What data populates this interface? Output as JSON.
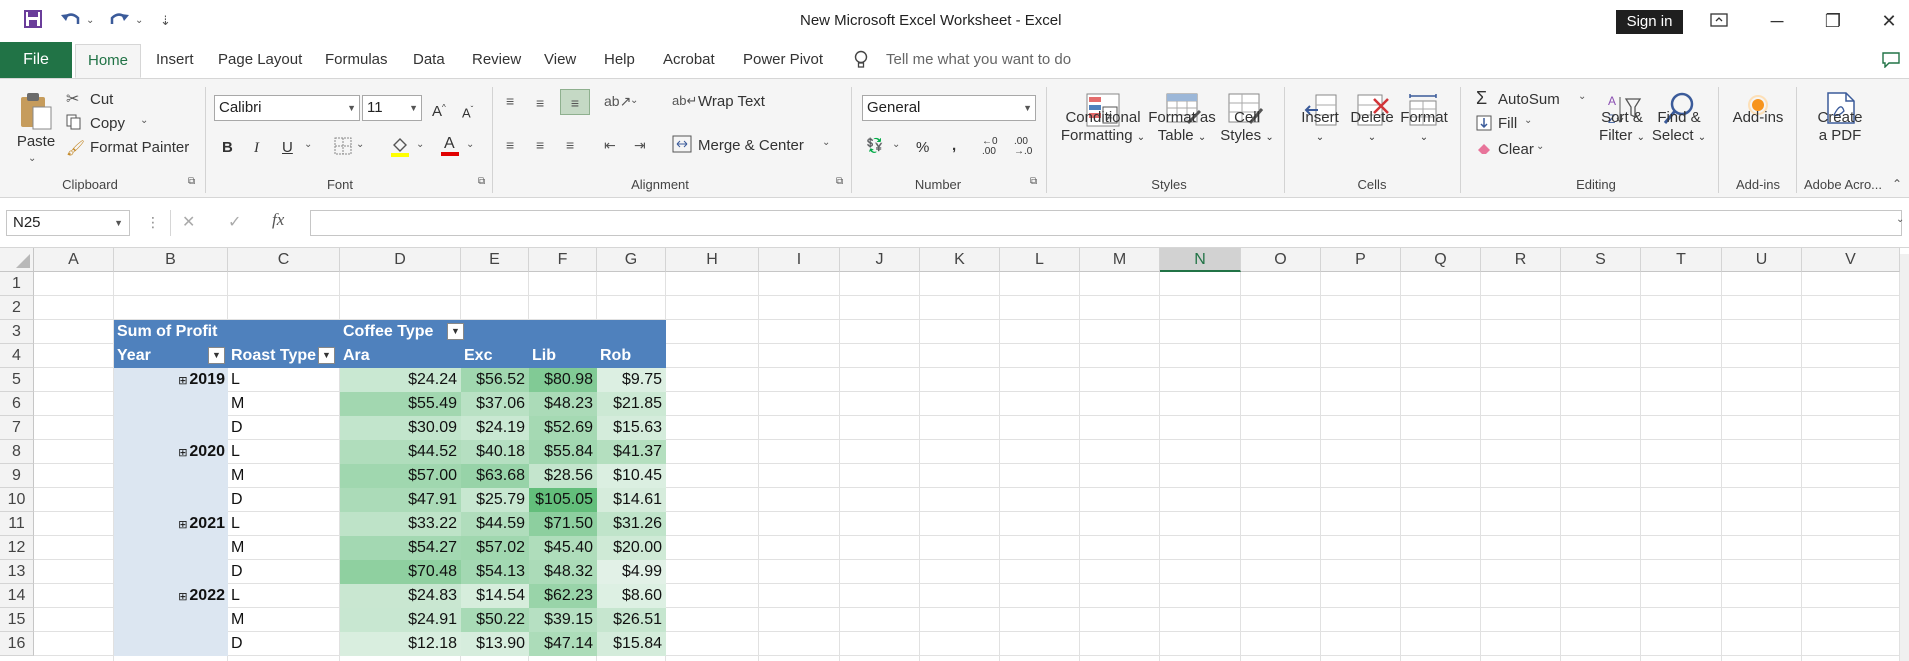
{
  "title_bar": {
    "title": "New Microsoft Excel Worksheet  -  Excel",
    "sign_in": "Sign in"
  },
  "tabs": {
    "file": "File",
    "home": "Home",
    "insert": "Insert",
    "page_layout": "Page Layout",
    "formulas": "Formulas",
    "data": "Data",
    "review": "Review",
    "view": "View",
    "help": "Help",
    "acrobat": "Acrobat",
    "power_pivot": "Power Pivot",
    "tell_me": "Tell me what you want to do"
  },
  "ribbon": {
    "clipboard": {
      "paste": "Paste",
      "cut": "Cut",
      "copy": "Copy",
      "format_painter": "Format Painter",
      "label": "Clipboard"
    },
    "font": {
      "name": "Calibri",
      "size": "11",
      "label": "Font"
    },
    "alignment": {
      "wrap": "Wrap Text",
      "merge": "Merge & Center",
      "label": "Alignment"
    },
    "number": {
      "format": "General",
      "label": "Number"
    },
    "styles": {
      "conditional": "Conditional",
      "conditional2": "Formatting",
      "format_as": "Format as",
      "format_as2": "Table",
      "cell": "Cell",
      "cell2": "Styles",
      "label": "Styles"
    },
    "cells": {
      "insert": "Insert",
      "delete": "Delete",
      "format": "Format",
      "label": "Cells"
    },
    "editing": {
      "autosum": "AutoSum",
      "fill": "Fill",
      "clear": "Clear",
      "sort": "Sort &",
      "sort2": "Filter",
      "find": "Find &",
      "find2": "Select",
      "label": "Editing"
    },
    "addins": {
      "addins": "Add-ins",
      "label": "Add-ins"
    },
    "adobe": {
      "create": "Create",
      "create2": "a PDF",
      "label": "Adobe Acro..."
    }
  },
  "formula_bar": {
    "name_box": "N25",
    "formula": ""
  },
  "columns": [
    "A",
    "B",
    "C",
    "D",
    "E",
    "F",
    "G",
    "H",
    "I",
    "J",
    "K",
    "L",
    "M",
    "N",
    "O",
    "P",
    "Q",
    "R",
    "S",
    "T",
    "U",
    "V"
  ],
  "rows": [
    "1",
    "2",
    "3",
    "4",
    "5",
    "6",
    "7",
    "8",
    "9",
    "10",
    "11",
    "12",
    "13",
    "14",
    "15",
    "16"
  ],
  "pivot": {
    "sum_label": "Sum of Profit",
    "coffee_type": "Coffee Type",
    "year": "Year",
    "roast_type": "Roast Type",
    "col_heads": [
      "Ara",
      "Exc",
      "Lib",
      "Rob"
    ],
    "years": [
      "2019",
      "2020",
      "2021",
      "2022"
    ],
    "roasts": [
      "L",
      "M",
      "D",
      "L",
      "M",
      "D",
      "L",
      "M",
      "D",
      "L",
      "M",
      "D"
    ],
    "values": [
      [
        "$24.24",
        "$56.52",
        "$80.98",
        "$9.75"
      ],
      [
        "$55.49",
        "$37.06",
        "$48.23",
        "$21.85"
      ],
      [
        "$30.09",
        "$24.19",
        "$52.69",
        "$15.63"
      ],
      [
        "$44.52",
        "$40.18",
        "$55.84",
        "$41.37"
      ],
      [
        "$57.00",
        "$63.68",
        "$28.56",
        "$10.45"
      ],
      [
        "$47.91",
        "$25.79",
        "$105.05",
        "$14.61"
      ],
      [
        "$33.22",
        "$44.59",
        "$71.50",
        "$31.26"
      ],
      [
        "$54.27",
        "$57.02",
        "$45.40",
        "$20.00"
      ],
      [
        "$70.48",
        "$54.13",
        "$48.32",
        "$4.99"
      ],
      [
        "$24.83",
        "$14.54",
        "$62.23",
        "$8.60"
      ],
      [
        "$24.91",
        "$50.22",
        "$39.15",
        "$26.51"
      ],
      [
        "$12.18",
        "$13.90",
        "$47.14",
        "$15.84"
      ]
    ]
  },
  "colors": {
    "excel_green": "#217346",
    "pivot_blue": "#4f81bd",
    "pivot_light": "#dce6f1"
  }
}
